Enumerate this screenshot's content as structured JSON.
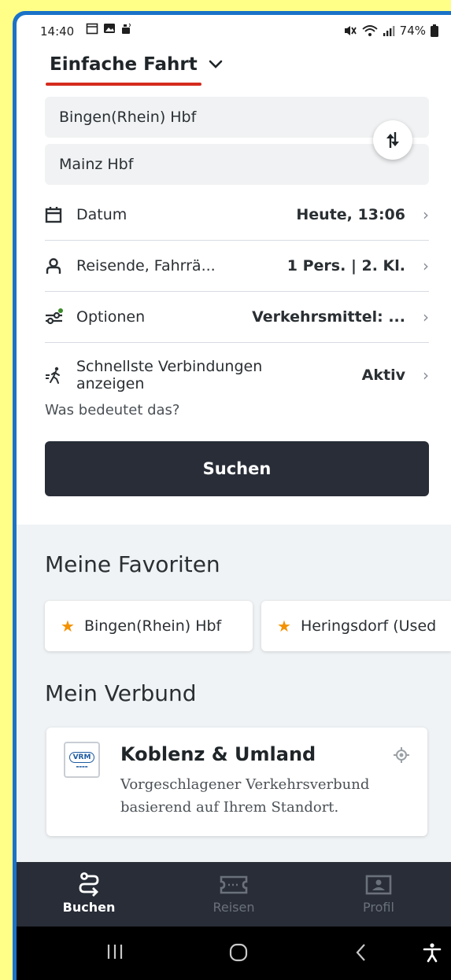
{
  "status_bar": {
    "time": "14:40",
    "battery": "74%"
  },
  "trip_type": {
    "label": "Einfache Fahrt"
  },
  "route": {
    "from": "Bingen(Rhein) Hbf",
    "to": "Mainz Hbf"
  },
  "rows": {
    "date": {
      "label": "Datum",
      "value": "Heute, 13:06"
    },
    "travellers": {
      "label": "Reisende, Fahrrä...",
      "value": "1 Pers. | 2. Kl."
    },
    "options": {
      "label": "Optionen",
      "value": "Verkehrsmittel: ..."
    },
    "fastest": {
      "label_line1": "Schnellste Verbindungen",
      "label_line2": "anzeigen",
      "value": "Aktiv"
    }
  },
  "help_link": "Was bedeutet das?",
  "search_button": "Suchen",
  "favorites": {
    "title": "Meine Favoriten",
    "items": [
      "Bingen(Rhein) Hbf",
      "Heringsdorf (Used"
    ]
  },
  "verbund": {
    "section_title": "Mein Verbund",
    "logo_text": "VRM",
    "name": "Koblenz & Umland",
    "description": "Vorgeschlagener Verkehrsverbund basierend auf Ihrem Standort."
  },
  "bottom_nav": [
    {
      "label": "Buchen",
      "active": true,
      "icon": "route-icon"
    },
    {
      "label": "Reisen",
      "active": false,
      "icon": "ticket-icon"
    },
    {
      "label": "Profil",
      "active": false,
      "icon": "profile-card-icon"
    }
  ],
  "colors": {
    "accent_red": "#d52b1e",
    "dark": "#282d37",
    "favorite_star": "#f39200",
    "frame_blue": "#1a73c8",
    "background_yellow": "#ffff88"
  }
}
